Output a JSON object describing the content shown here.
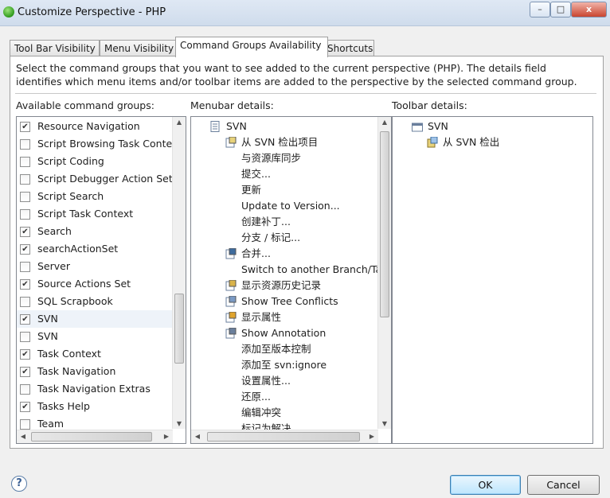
{
  "window": {
    "title": "Customize Perspective - PHP",
    "minimize": "–",
    "maximize": "□",
    "close": "x"
  },
  "tabs": [
    "Tool Bar Visibility",
    "Menu Visibility",
    "Command Groups Availability",
    "Shortcuts"
  ],
  "description": "Select the command groups that you want to see added to the current perspective (PHP).  The details field identifies which menu items and/or toolbar items are added to the perspective by the selected command group.",
  "headers": {
    "available": "Available command groups:",
    "menubar": "Menubar details:",
    "toolbar": "Toolbar details:"
  },
  "groups": [
    {
      "label": "Resource Navigation",
      "checked": "✔"
    },
    {
      "label": "Script Browsing Task Context",
      "checked": ""
    },
    {
      "label": "Script Coding",
      "checked": ""
    },
    {
      "label": "Script Debugger Action Set",
      "checked": ""
    },
    {
      "label": "Script Search",
      "checked": ""
    },
    {
      "label": "Script Task Context",
      "checked": ""
    },
    {
      "label": "Search",
      "checked": "✔"
    },
    {
      "label": "searchActionSet",
      "checked": "✔"
    },
    {
      "label": "Server",
      "checked": ""
    },
    {
      "label": "Source Actions Set",
      "checked": "✔"
    },
    {
      "label": "SQL Scrapbook",
      "checked": ""
    },
    {
      "label": "SVN",
      "checked": "✔"
    },
    {
      "label": "SVN",
      "checked": ""
    },
    {
      "label": "Task Context",
      "checked": "✔"
    },
    {
      "label": "Task Navigation",
      "checked": "✔"
    },
    {
      "label": "Task Navigation Extras",
      "checked": ""
    },
    {
      "label": "Tasks Help",
      "checked": "✔"
    },
    {
      "label": "Team",
      "checked": ""
    }
  ],
  "menubar": {
    "root": "SVN",
    "items": [
      "从 SVN 检出项目",
      "与资源库同步",
      "提交...",
      "更新",
      "Update to Version...",
      "创建补丁...",
      "分支 / 标记...",
      "合并...",
      "Switch to another Branch/Tag",
      "显示资源历史记录",
      "Show Tree Conflicts",
      "显示属性",
      "Show Annotation",
      "添加至版本控制",
      "添加至 svn:ignore",
      "设置属性...",
      "还原...",
      "编辑冲突",
      "标记为解决"
    ]
  },
  "toolbar": {
    "root": "SVN",
    "items": [
      "从 SVN 检出"
    ]
  },
  "buttons": {
    "ok": "OK",
    "cancel": "Cancel",
    "help": "?"
  }
}
